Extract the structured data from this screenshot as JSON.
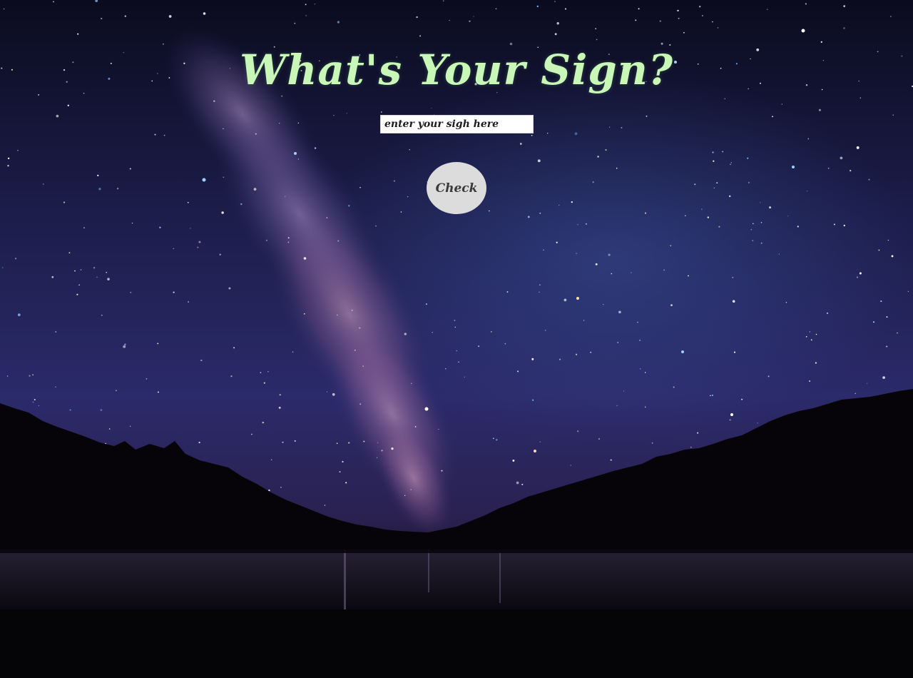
{
  "header": {
    "title": "What's Your Sign?"
  },
  "form": {
    "input_placeholder": "enter your sigh here",
    "input_value": "",
    "check_label": "Check"
  },
  "background": {
    "description_icon": "night-sky-image"
  },
  "colors": {
    "title": "#c9f7b8",
    "button_bg": "#dcdcdc",
    "input_bg": "#ffffff",
    "page_bg": "#050407"
  }
}
